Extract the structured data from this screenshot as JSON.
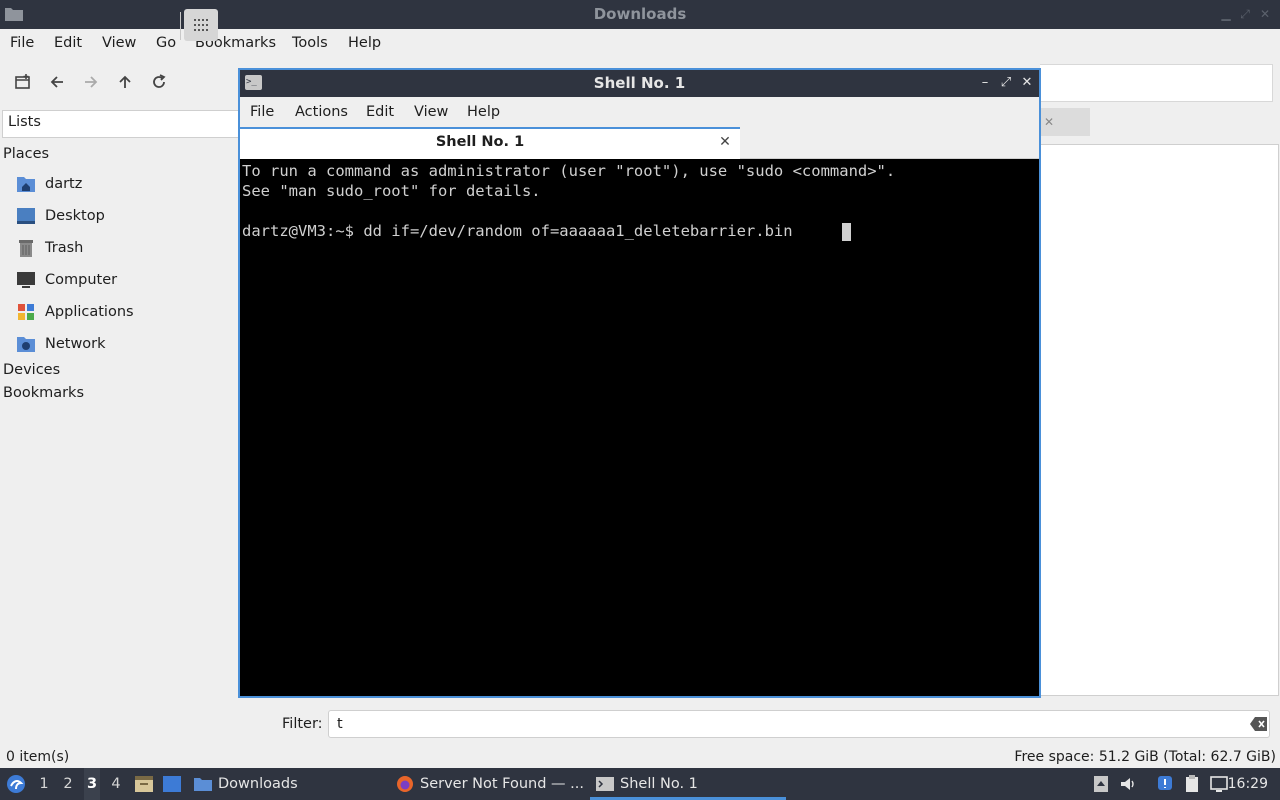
{
  "file_manager": {
    "title": "Downloads",
    "menu": [
      "File",
      "Edit",
      "View",
      "Go",
      "Bookmarks",
      "Tools",
      "Help"
    ],
    "side_header": "Lists",
    "sections": {
      "places": "Places",
      "devices": "Devices",
      "bookmarks": "Bookmarks"
    },
    "places": [
      "dartz",
      "Desktop",
      "Trash",
      "Computer",
      "Applications",
      "Network"
    ],
    "filter_label": "Filter:",
    "filter_value": "t",
    "status_items": "0 item(s)",
    "status_space": "Free space: 51.2 GiB (Total: 62.7 GiB)"
  },
  "terminal": {
    "title": "Shell No. 1",
    "menu": [
      "File",
      "Actions",
      "Edit",
      "View",
      "Help"
    ],
    "tab_label": "Shell No. 1",
    "lines": [
      "To run a command as administrator (user \"root\"), use \"sudo <command>\".",
      "See \"man sudo_root\" for details.",
      "",
      "dartz@VM3:~$ dd if=/dev/random of=aaaaaa1_deletebarrier.bin "
    ]
  },
  "taskbar": {
    "workspaces": [
      "1",
      "2",
      "3",
      "4"
    ],
    "active_workspace": "3",
    "tasks": [
      "Downloads",
      "Server Not Found — ...",
      "Shell No. 1"
    ],
    "clock": "16:29"
  },
  "colors": {
    "accent": "#4a90d9",
    "titlebar": "#2f3440",
    "terminal_bg": "#000000"
  }
}
